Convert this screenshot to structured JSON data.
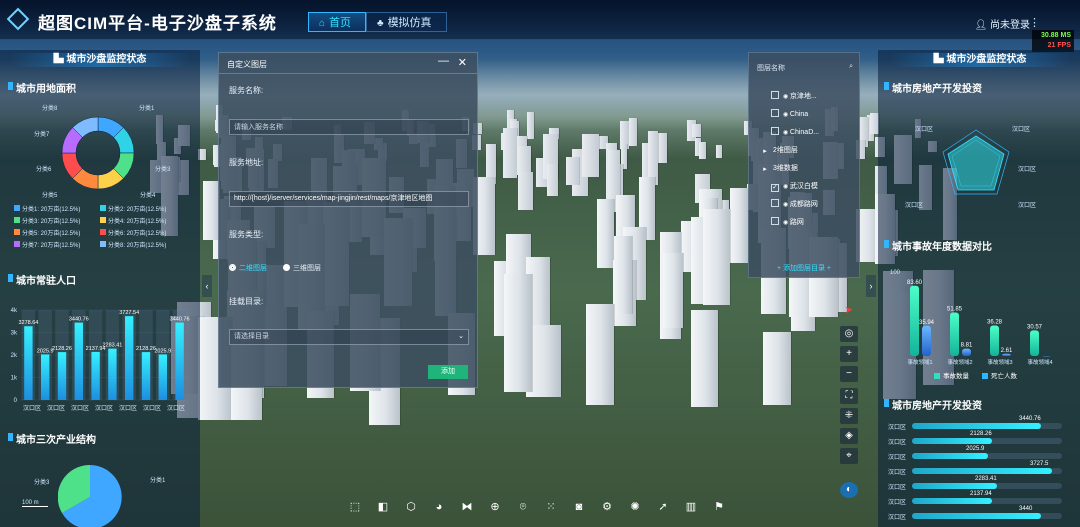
{
  "header": {
    "title": "超图CIM平台-电子沙盘子系统",
    "tabs": [
      {
        "label": "首页",
        "icon": "home-icon",
        "active": true
      },
      {
        "label": "模拟仿真",
        "icon": "people-icon",
        "active": false
      }
    ],
    "user_label": "尚未登录",
    "fps_ms": "30.88 MS",
    "fps": "21 FPS"
  },
  "left_panel": {
    "header": "城市沙盘监控状态",
    "land": {
      "title": "城市用地面积",
      "slice_labels": [
        "分类1",
        "分类2",
        "分类3",
        "分类4",
        "分类5",
        "分类6",
        "分类7",
        "分类8"
      ],
      "legend": [
        "分类1: 20万亩(12.5%)",
        "分类2: 20万亩(12.5%)",
        "分类3: 20万亩(12.5%)",
        "分类4: 20万亩(12.5%)",
        "分类5: 20万亩(12.5%)",
        "分类6: 20万亩(12.5%)",
        "分类7: 20万亩(12.5%)",
        "分类8: 20万亩(12.5%)"
      ],
      "colors": [
        "#3fa7ff",
        "#2fd3e6",
        "#4fe08a",
        "#ffd04a",
        "#ff8a3d",
        "#ff4d4d",
        "#b76cff",
        "#7fbcff"
      ]
    },
    "population": {
      "title": "城市常驻人口",
      "y_ticks": [
        "4k",
        "3k",
        "2k",
        "1k",
        "0"
      ],
      "x_labels": [
        "汉口区",
        "汉口区",
        "汉口区",
        "汉口区",
        "汉口区",
        "汉口区",
        "汉口区"
      ],
      "values_labels": [
        "3278.64",
        "2025.9",
        "2128.26",
        "3440.76",
        "2137.94",
        "2283.41",
        "3727.54",
        "2128.26",
        "2025.9",
        "3440.76"
      ]
    },
    "industry_title": "城市三次产业结构",
    "industry_label": "分类1",
    "industry_label2": "分类3",
    "scale_label": "100 m"
  },
  "dialog": {
    "title": "自定义图层",
    "service_name_label": "服务名称:",
    "service_name_placeholder": "请输入服务名称",
    "service_url_label": "服务地址:",
    "service_url_value": "http://{host}/iserver/services/map-jingjin/rest/maps/京津地区地图",
    "service_type_label": "服务类型:",
    "type_2d": "二维图层",
    "type_3d": "三维图层",
    "mount_label": "挂载目录:",
    "mount_placeholder": "请选择目录",
    "add_label": "添加"
  },
  "layer_tree": {
    "search_placeholder": "图层名称",
    "items": [
      {
        "label": "京津地...",
        "checked": false,
        "indent": 1
      },
      {
        "label": "China",
        "checked": false,
        "indent": 1
      },
      {
        "label": "ChinaD...",
        "checked": false,
        "indent": 1
      },
      {
        "label": "2维图层",
        "checked": false,
        "indent": 0
      },
      {
        "label": "3维数据",
        "checked": false,
        "indent": 0
      },
      {
        "label": "武汉白模",
        "checked": true,
        "indent": 1
      },
      {
        "label": "成都路网",
        "checked": false,
        "indent": 1
      },
      {
        "label": "路网",
        "checked": false,
        "indent": 1
      }
    ],
    "footer": "+ 添加图层目录 +"
  },
  "right_panel": {
    "header": "城市沙盘监控状态",
    "realestate_title": "城市房地产开发投资",
    "radar_labels": [
      "汉口区",
      "汉口区",
      "汉口区",
      "汉口区",
      "汉口区"
    ],
    "compare_title": "城市事故年度数据对比",
    "compare_y_top": "100",
    "compare_values": [
      "83.60",
      "35.94",
      "51.85",
      "8.81",
      "36.28",
      "2.61",
      "30.57"
    ],
    "compare_x": [
      "事故领域1",
      "事故领域2",
      "事故领域3",
      "事故领域4"
    ],
    "legend_a": "事故数量",
    "legend_b": "死亡人数",
    "invest_title": "城市房地产开发投资",
    "bars": [
      {
        "label": "汉口区",
        "value": "3440.76",
        "frac": 0.92
      },
      {
        "label": "汉口区",
        "value": "2128.26",
        "frac": 0.57
      },
      {
        "label": "汉口区",
        "value": "2025.9",
        "frac": 0.54
      },
      {
        "label": "汉口区",
        "value": "3727.5",
        "frac": 1.0
      },
      {
        "label": "汉口区",
        "value": "2283.41",
        "frac": 0.61
      },
      {
        "label": "汉口区",
        "value": "2137.94",
        "frac": 0.57
      },
      {
        "label": "汉口区",
        "value": "3440",
        "frac": 0.92
      }
    ]
  },
  "chart_data": [
    {
      "type": "pie",
      "title": "城市用地面积",
      "categories": [
        "分类1",
        "分类2",
        "分类3",
        "分类4",
        "分类5",
        "分类6",
        "分类7",
        "分类8"
      ],
      "values": [
        20,
        20,
        20,
        20,
        20,
        20,
        20,
        20
      ]
    },
    {
      "type": "bar",
      "title": "城市常驻人口",
      "categories": [
        "汉口区",
        "汉口区",
        "汉口区",
        "汉口区",
        "汉口区",
        "汉口区",
        "汉口区",
        "汉口区",
        "汉口区",
        "汉口区"
      ],
      "values": [
        3278.64,
        2025.9,
        2128.26,
        3440.76,
        2137.94,
        2283.41,
        3727.54,
        2128.26,
        2025.9,
        3440.76
      ],
      "ylim": [
        0,
        4000
      ]
    },
    {
      "type": "bar",
      "title": "城市事故年度数据对比",
      "categories": [
        "事故领域1",
        "事故领域2",
        "事故领域3",
        "事故领域4"
      ],
      "series": [
        {
          "name": "事故数量",
          "values": [
            83.6,
            51.85,
            36.28,
            30.57
          ]
        },
        {
          "name": "死亡人数",
          "values": [
            35.94,
            8.81,
            2.61,
            0
          ]
        }
      ],
      "ylim": [
        0,
        100
      ]
    }
  ]
}
